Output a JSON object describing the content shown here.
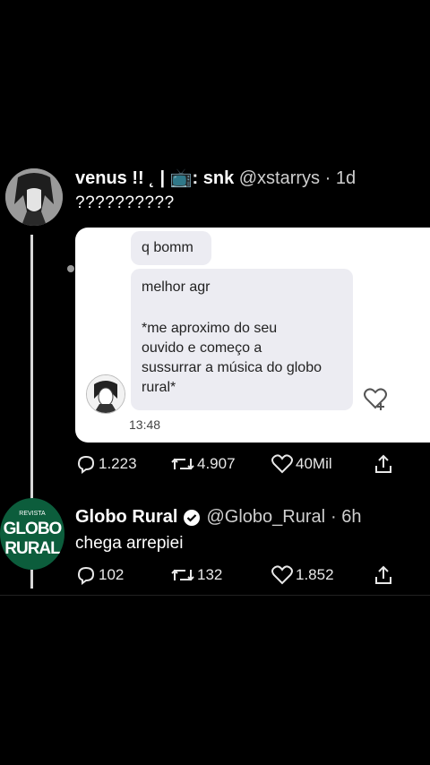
{
  "tweet1": {
    "display_name": "venus !! ˛ | 📺: snk",
    "handle": "@xstarrys",
    "age": "· 1d",
    "text": "??????????",
    "screenshot": {
      "message1": "q bomm",
      "message2_lines": [
        "melhor agr",
        "",
        "*me aproximo do seu",
        "ouvido e começo a",
        "sussurrar a música do globo",
        "rural*"
      ],
      "time": "13:48"
    },
    "replies": "1.223",
    "retweets": "4.907",
    "likes": "40Mil"
  },
  "tweet2": {
    "avatar_text": {
      "top": "REVISTA",
      "line1": "GLOBO",
      "line2": "RURAL"
    },
    "display_name": "Globo Rural",
    "handle": "@Globo_Rural",
    "age": "· 6h",
    "text": "chega arrepiei",
    "replies": "102",
    "retweets": "132",
    "likes": "1.852"
  },
  "colors": {
    "background": "#000000",
    "avatar_green": "#0c5d3c",
    "verified": "#ffffff"
  }
}
